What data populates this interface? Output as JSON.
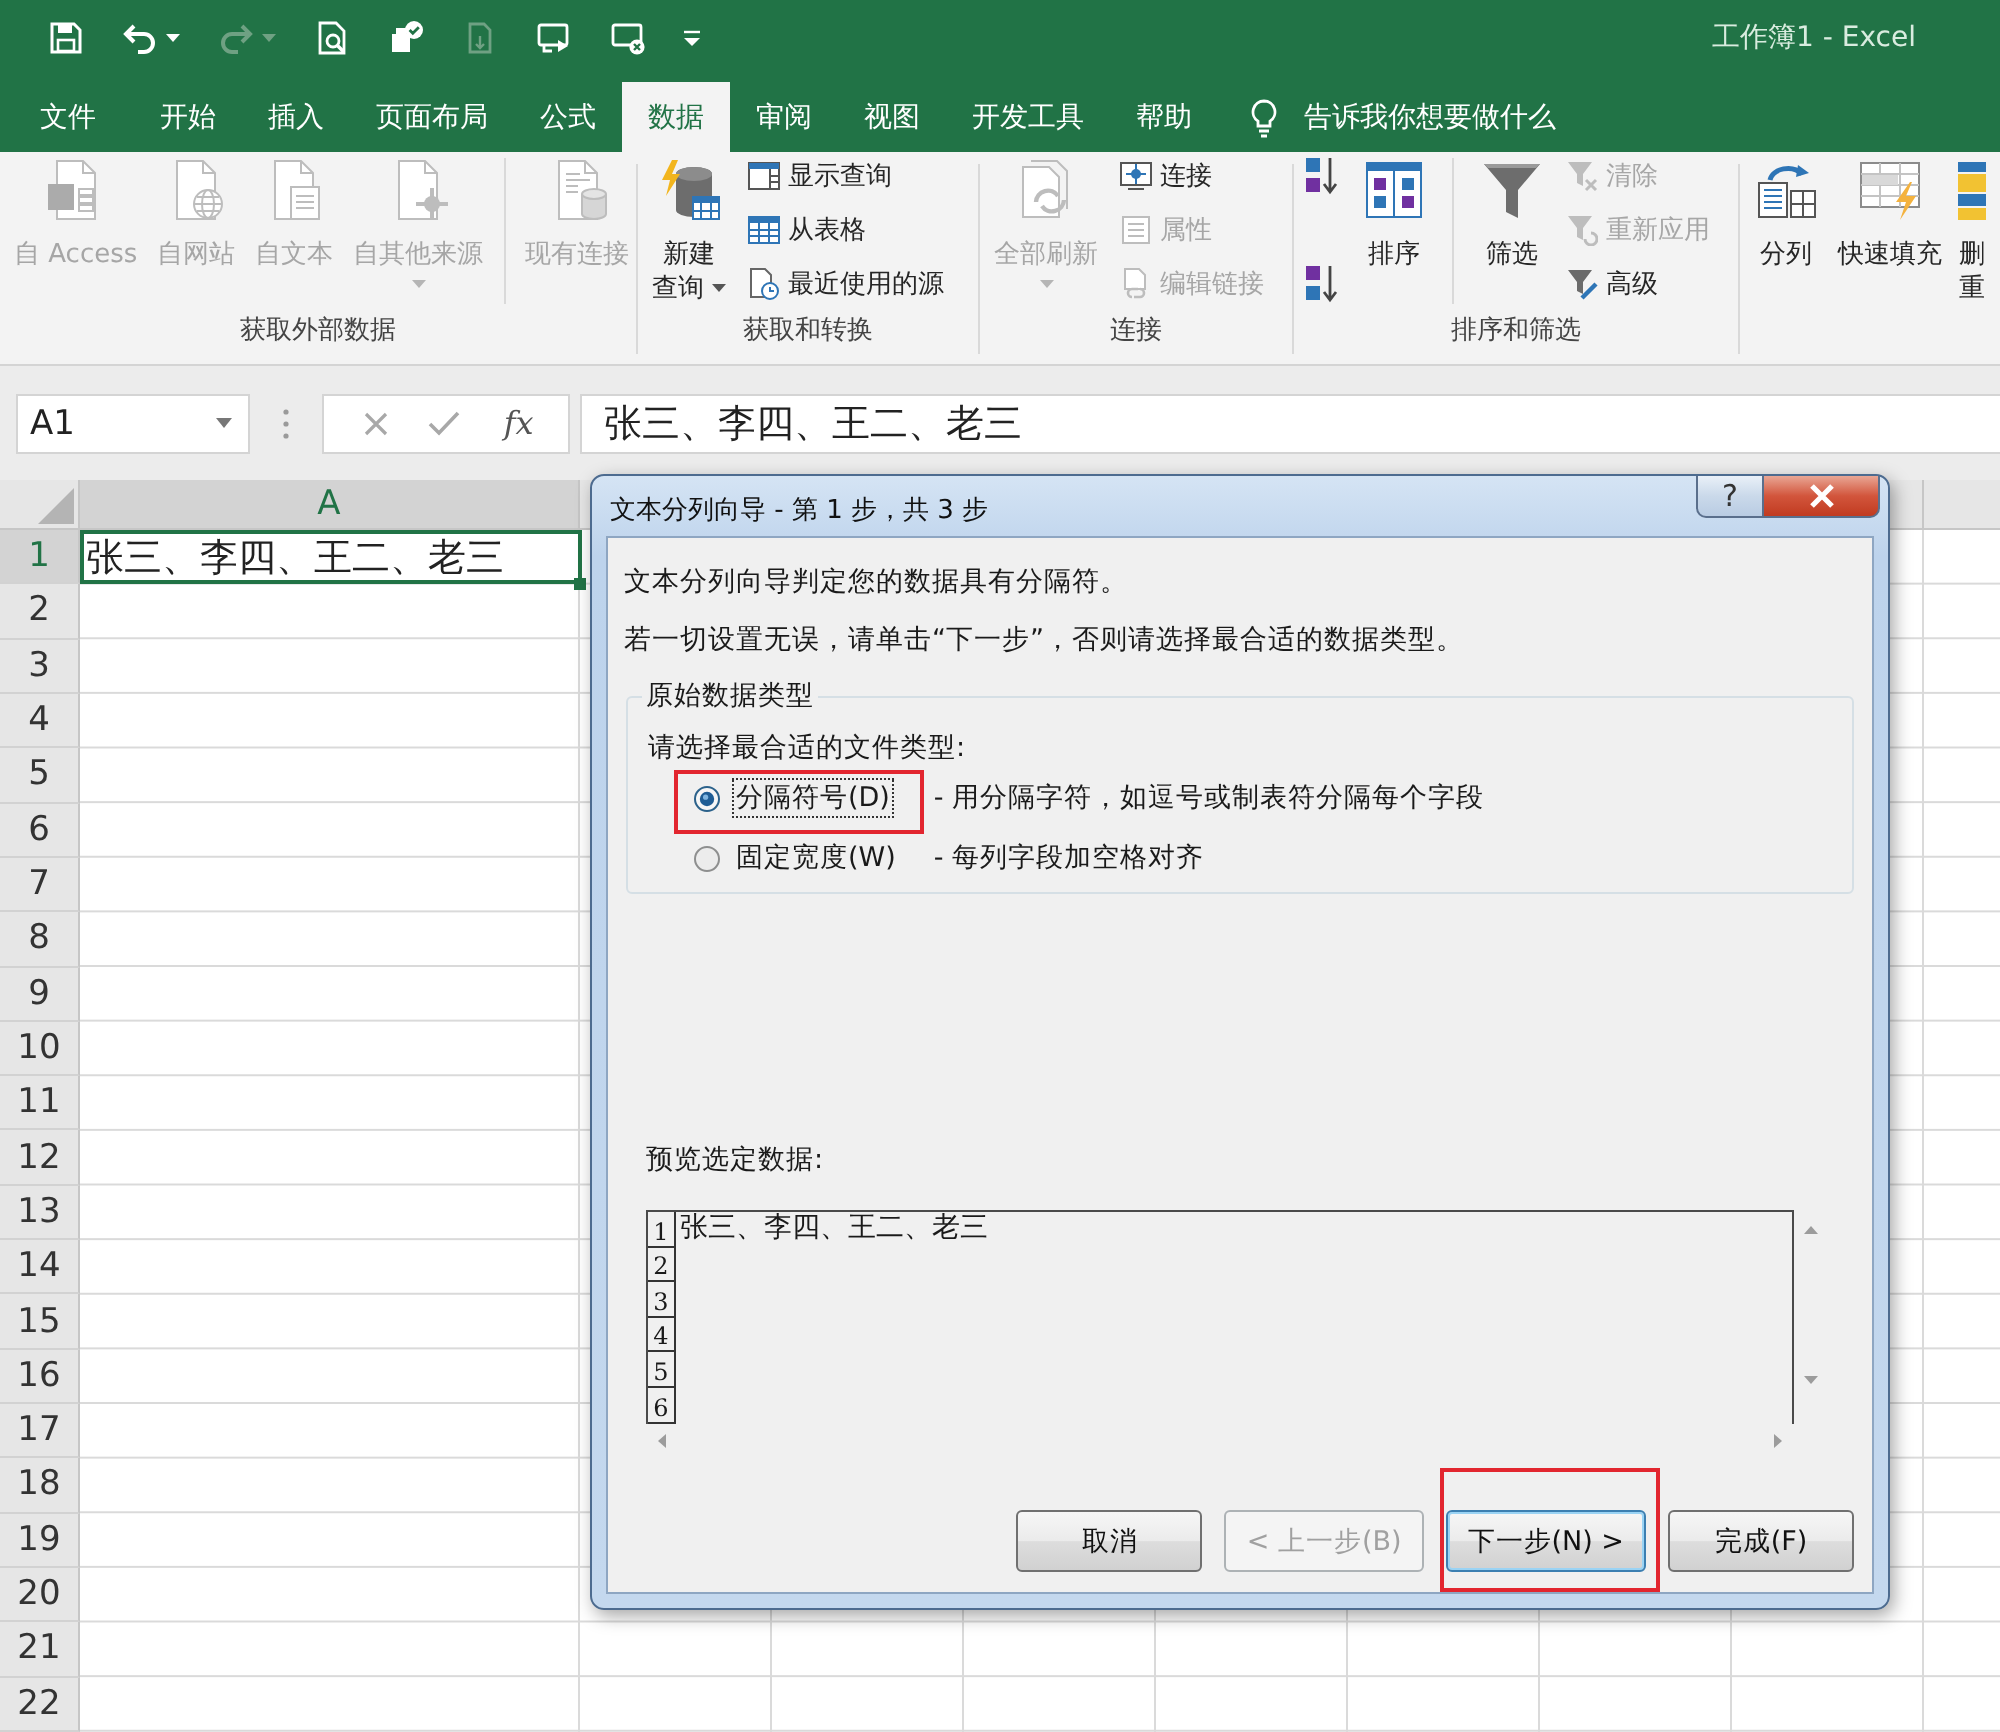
{
  "title_bar": {
    "quick_access": [
      {
        "disabled": false,
        "dropdown": false
      },
      {
        "disabled": false,
        "dropdown": true
      },
      {
        "disabled": true,
        "dropdown": true
      },
      {
        "disabled": false,
        "dropdown": false
      },
      {
        "disabled": false,
        "dropdown": false
      },
      {
        "disabled": true,
        "dropdown": false
      },
      {
        "disabled": false,
        "dropdown": false
      },
      {
        "disabled": false,
        "dropdown": false
      }
    ],
    "title": "工作簿1 - Excel"
  },
  "tabs": [
    {
      "label": "文件",
      "selected": false
    },
    {
      "label": "开始",
      "selected": false
    },
    {
      "label": "插入",
      "selected": false
    },
    {
      "label": "页面布局",
      "selected": false
    },
    {
      "label": "公式",
      "selected": false
    },
    {
      "label": "数据",
      "selected": true
    },
    {
      "label": "审阅",
      "selected": false
    },
    {
      "label": "视图",
      "selected": false
    },
    {
      "label": "开发工具",
      "selected": false
    },
    {
      "label": "帮助",
      "selected": false
    }
  ],
  "tell_me": {
    "label": "告诉我你想要做什么"
  },
  "ribbon": {
    "groups": [
      {
        "label": "获取外部数据",
        "items": [
          {
            "kind": "large",
            "label_lines": [
              "自 Access"
            ],
            "disabled": true,
            "dropdown": false
          },
          {
            "kind": "large",
            "label_lines": [
              "自网站"
            ],
            "disabled": true,
            "dropdown": false
          },
          {
            "kind": "large",
            "label_lines": [
              "自文本"
            ],
            "disabled": true,
            "dropdown": false
          },
          {
            "kind": "large",
            "label_lines": [
              "自其他来源"
            ],
            "disabled": true,
            "dropdown": true
          },
          {
            "kind": "separator"
          },
          {
            "kind": "large",
            "label_lines": [
              "现有连接"
            ],
            "disabled": true,
            "dropdown": false
          }
        ]
      },
      {
        "label": "获取和转换",
        "items": [
          {
            "kind": "large",
            "label_lines": [
              "新建",
              "查询"
            ],
            "disabled": false,
            "dropdown": true
          },
          {
            "kind": "stack",
            "buttons": [
              {
                "label": "显示查询",
                "disabled": false
              },
              {
                "label": "从表格",
                "disabled": false
              },
              {
                "label": "最近使用的源",
                "disabled": false
              }
            ]
          }
        ]
      },
      {
        "label": "连接",
        "items": [
          {
            "kind": "large",
            "label_lines": [
              "全部刷新"
            ],
            "disabled": true,
            "dropdown": true
          },
          {
            "kind": "stack",
            "buttons": [
              {
                "label": "连接",
                "disabled": false
              },
              {
                "label": "属性",
                "disabled": true
              },
              {
                "label": "编辑链接",
                "disabled": true
              }
            ]
          }
        ]
      },
      {
        "label": "排序和筛选",
        "items": [
          {
            "kind": "stack",
            "buttons": [
              {
                "disabled": false
              },
              {
                "disabled": false
              }
            ]
          },
          {
            "kind": "large",
            "label_lines": [
              "排序"
            ],
            "disabled": false,
            "dropdown": false
          },
          {
            "kind": "separator"
          },
          {
            "kind": "large",
            "label_lines": [
              "筛选"
            ],
            "disabled": false,
            "dropdown": false
          },
          {
            "kind": "stack",
            "buttons": [
              {
                "label": "清除",
                "disabled": true
              },
              {
                "label": "重新应用",
                "disabled": true
              },
              {
                "label": "高级",
                "disabled": false
              }
            ]
          }
        ]
      },
      {
        "items": [
          {
            "kind": "large",
            "label_lines": [
              "分列"
            ],
            "disabled": false,
            "dropdown": false
          },
          {
            "kind": "large",
            "label_lines": [
              "快速填充"
            ],
            "disabled": false,
            "dropdown": false
          },
          {
            "kind": "large",
            "label_lines": [
              "删",
              "重"
            ],
            "disabled": false,
            "dropdown": false
          }
        ]
      }
    ]
  },
  "formula_bar": {
    "name_box": "A1",
    "function_button": "fx",
    "formula": "张三、李四、王二、老三"
  },
  "sheet": {
    "columns": [
      {
        "label": "A",
        "selected": true
      }
    ],
    "rows": [
      {
        "header": "1",
        "selected": true,
        "cells": [
          "张三、李四、王二、老三"
        ]
      },
      {
        "header": "2",
        "selected": false
      },
      {
        "header": "3",
        "selected": false
      },
      {
        "header": "4",
        "selected": false
      },
      {
        "header": "5",
        "selected": false
      },
      {
        "header": "6",
        "selected": false
      },
      {
        "header": "7",
        "selected": false
      },
      {
        "header": "8",
        "selected": false
      },
      {
        "header": "9",
        "selected": false
      },
      {
        "header": "10",
        "selected": false
      },
      {
        "header": "11",
        "selected": false
      },
      {
        "header": "12",
        "selected": false
      },
      {
        "header": "13",
        "selected": false
      },
      {
        "header": "14",
        "selected": false
      },
      {
        "header": "15",
        "selected": false
      },
      {
        "header": "16",
        "selected": false
      },
      {
        "header": "17",
        "selected": false
      },
      {
        "header": "18",
        "selected": false
      },
      {
        "header": "19",
        "selected": false
      },
      {
        "header": "20",
        "selected": false
      },
      {
        "header": "21",
        "selected": false
      },
      {
        "header": "22",
        "selected": false
      }
    ]
  },
  "dialog": {
    "title": "文本分列向导 - 第 1 步，共 3 步",
    "help_button": "?",
    "intro": "文本分列向导判定您的数据具有分隔符。",
    "instruction": "若一切设置无误，请单击“下一步”，否则请选择最合适的数据类型。",
    "group": {
      "legend": "原始数据类型",
      "prompt": "请选择最合适的文件类型:",
      "options": [
        {
          "label": "分隔符号(D)",
          "description": "- 用分隔字符，如逗号或制表符分隔每个字段",
          "selected": true,
          "focused": true,
          "highlighted": true
        },
        {
          "label": "固定宽度(W)",
          "description": "- 每列字段加空格对齐",
          "selected": false,
          "focused": false,
          "highlighted": false
        }
      ]
    },
    "preview": {
      "label": "预览选定数据:",
      "lines": [
        {
          "number": "1",
          "text": "张三、李四、王二、老三"
        },
        {
          "number": "2"
        },
        {
          "number": "3"
        },
        {
          "number": "4"
        },
        {
          "number": "5"
        },
        {
          "number": "6"
        }
      ]
    },
    "buttons": [
      {
        "label": "取消",
        "disabled": false,
        "default": false,
        "highlighted": false
      },
      {
        "label": "< 上一步(B)",
        "disabled": true,
        "default": false,
        "highlighted": false
      },
      {
        "label": "下一步(N) >",
        "disabled": false,
        "default": true,
        "highlighted": true
      },
      {
        "label": "完成(F)",
        "disabled": false,
        "default": false,
        "highlighted": false
      }
    ]
  }
}
